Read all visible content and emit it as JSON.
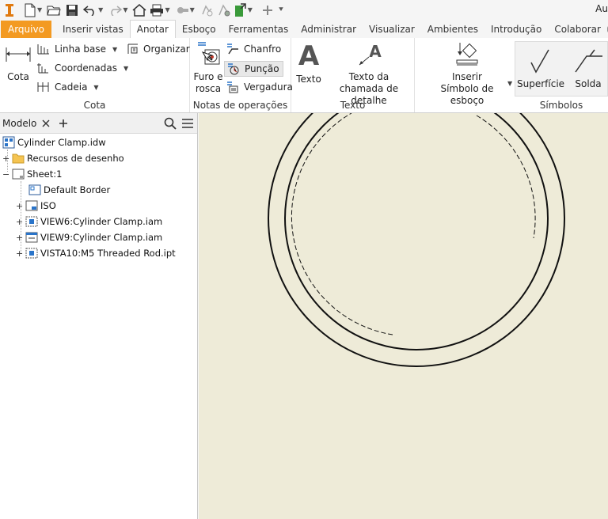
{
  "app": {
    "title_fragment": "Au"
  },
  "tabs": [
    "Arquivo",
    "Inserir vistas",
    "Anotar",
    "Esboço",
    "Ferramentas",
    "Administrar",
    "Visualizar",
    "Ambientes",
    "Introdução",
    "Colaborar"
  ],
  "active_tab": "Anotar",
  "ribbon": {
    "cota": {
      "title": "Cota",
      "cota_label": "Cota",
      "linha_base": "Linha base",
      "coordenadas": "Coordenadas",
      "cadeia": "Cadeia",
      "organizar": "Organizar"
    },
    "notas": {
      "title": "Notas de operações",
      "furo_line1": "Furo e",
      "furo_line2": "rosca",
      "chanfro": "Chanfro",
      "puncao": "Punção",
      "vergadura": "Vergadura"
    },
    "texto": {
      "title": "Texto",
      "texto": "Texto",
      "chamada_line1": "Texto da",
      "chamada_line2": "chamada de detalhe"
    },
    "simbolos": {
      "title": "Símbolos",
      "inserir_line1": "Inserir",
      "inserir_line2": "Símbolo de esboço",
      "superficie": "Superfície",
      "solda": "Solda"
    }
  },
  "browser": {
    "tab_label": "Modelo",
    "items": [
      {
        "label": "Cylinder Clamp.idw"
      },
      {
        "label": "Recursos de desenho"
      },
      {
        "label": "Sheet:1"
      },
      {
        "label": "Default Border"
      },
      {
        "label": "ISO"
      },
      {
        "label": "VIEW6:Cylinder Clamp.iam"
      },
      {
        "label": "VIEW9:Cylinder Clamp.iam"
      },
      {
        "label": "VISTA10:M5 Threaded Rod.ipt"
      }
    ]
  },
  "colors": {
    "file_tab": "#f39a22",
    "canvas": "#eeebd8"
  }
}
